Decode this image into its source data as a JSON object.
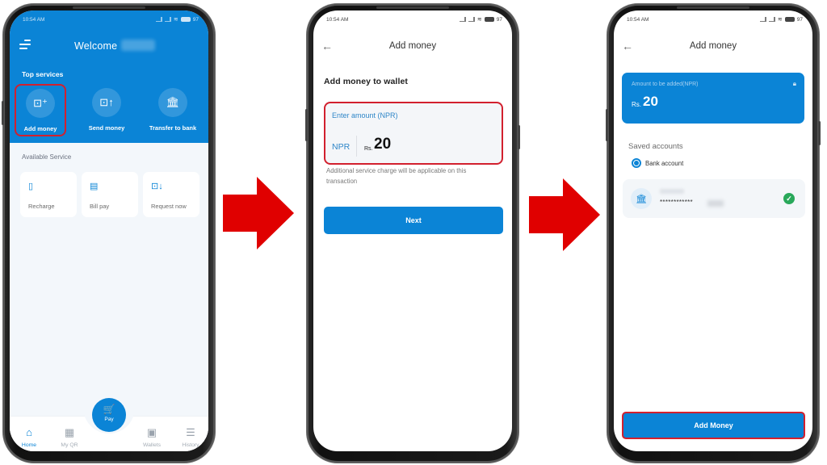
{
  "colors": {
    "brand_blue": "#0b84d6",
    "highlight_red": "#d2202e",
    "arrow_red": "#e00000",
    "success_green": "#29a85a"
  },
  "status_bar": {
    "time": "10:54 AM",
    "battery": "97"
  },
  "screen1": {
    "welcome": "Welcome",
    "top_services_label": "Top services",
    "top_services": [
      {
        "label": "Add money",
        "icon": "wallet-plus-icon",
        "glyph": "⊡⁺"
      },
      {
        "label": "Send money",
        "icon": "money-send-icon",
        "glyph": "⊡↑"
      },
      {
        "label": "Transfer to bank",
        "icon": "bank-transfer-icon",
        "glyph": "🏛"
      }
    ],
    "available_label": "Available Service",
    "available_services": [
      {
        "label": "Recharge",
        "icon": "phone-recharge-icon",
        "glyph": "▯"
      },
      {
        "label": "Bill pay",
        "icon": "bill-icon",
        "glyph": "▤"
      },
      {
        "label": "Request now",
        "icon": "money-request-icon",
        "glyph": "⊡↓"
      }
    ],
    "bottom_nav": [
      {
        "label": "Home",
        "icon": "home-icon",
        "glyph": "⌂",
        "active": true
      },
      {
        "label": "My QR",
        "icon": "qr-icon",
        "glyph": "▦",
        "active": false
      },
      {
        "label": "Wallets",
        "icon": "wallet-icon",
        "glyph": "▣",
        "active": false
      },
      {
        "label": "History",
        "icon": "history-icon",
        "glyph": "☰",
        "active": false
      }
    ],
    "pay": {
      "label": "Pay",
      "icon": "pay-icon",
      "glyph": "🛒"
    }
  },
  "screen2": {
    "title": "Add money",
    "subtitle": "Add money to wallet",
    "amount_label": "Enter amount (NPR)",
    "currency": "NPR",
    "rs_prefix": "Rs.",
    "amount": "20",
    "note": "Additional service charge will be applicable on this transaction",
    "next_label": "Next"
  },
  "screen3": {
    "title": "Add money",
    "amount_label": "Amount to be added(NPR)",
    "rs_prefix": "Rs.",
    "amount": "20",
    "saved_label": "Saved accounts",
    "radio_label": "Bank account",
    "account_mask": "************",
    "add_money_label": "Add Money"
  }
}
